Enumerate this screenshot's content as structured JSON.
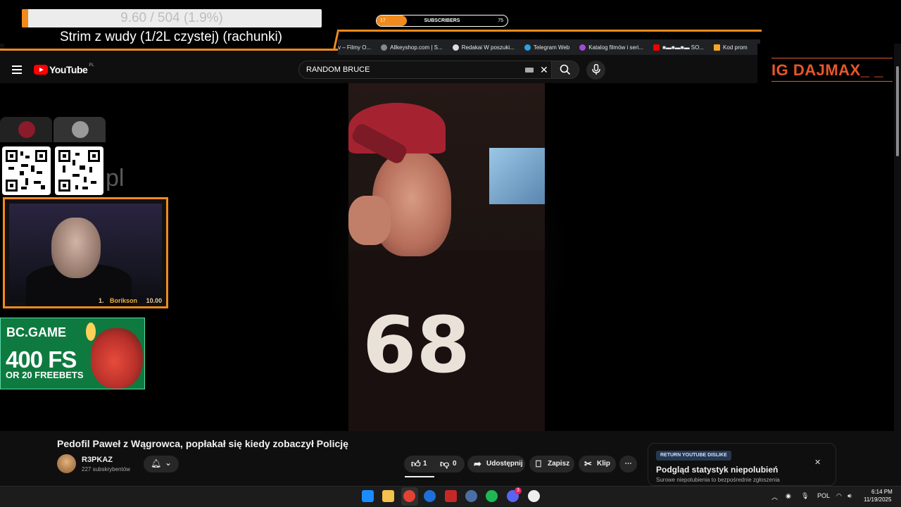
{
  "overlay": {
    "goal_text": "9.60 / 504 (1.9%)",
    "goal_progress": 0.019,
    "stream_title": "Strim z wudy (1/2L czystej) (rachunki)",
    "subs_current": "17",
    "subs_label": "SUBSCRIBERS",
    "subs_goal": "75",
    "subs_progress": 0.23,
    "ig_label": "IG DAJMAX_ _",
    "pl_text": "pl",
    "leaderboard_rank": "1.",
    "leaderboard_name": "Borikson",
    "leaderboard_amount": "10.00",
    "bc_logo": "BC.GAME",
    "bc_fs": "400 FS",
    "bc_freebets": "OR 20 FREEBETS",
    "accent": "#f08a1d"
  },
  "bookmarks": [
    {
      "label": "v – Filmy O...",
      "icon": "bookmark-icon"
    },
    {
      "label": "Allkeyshop.com | S...",
      "icon": "allkeyshop-icon"
    },
    {
      "label": "Redakai W poszuki...",
      "icon": "chrome-icon"
    },
    {
      "label": "Telegram Web",
      "icon": "telegram-icon"
    },
    {
      "label": "Katalog filmów i seri...",
      "icon": "catalog-icon"
    },
    {
      "label": "■▬■▬■▬ SO...",
      "icon": "youtube-icon"
    },
    {
      "label": "Kod prom",
      "icon": "grid-icon"
    }
  ],
  "youtube": {
    "logo": "YouTube",
    "country": "PL",
    "search_value": "RANDOM BRUCE",
    "video_title": "Pedofil Paweł z Wągrowca, popłakał się kiedy zobaczył Policję",
    "channel_name": "R3PKAZ",
    "channel_subs": "227 subskrybentów",
    "likes": "1",
    "dislikes": "0",
    "share": "Udostępnij",
    "save": "Zapisz",
    "clip": "Klip",
    "brand_red": "#ff0000"
  },
  "ryd": {
    "badge": "RETURN YOUTUBE DISLIKE",
    "title": "Podgląd statystyk niepolubień",
    "desc": "Surowe niepolubienia to bezpośrednie zgłoszenia"
  },
  "taskbar": {
    "lang": "POL",
    "time": "6:14 PM",
    "date": "11/19/2025",
    "discord_badge": "3"
  }
}
